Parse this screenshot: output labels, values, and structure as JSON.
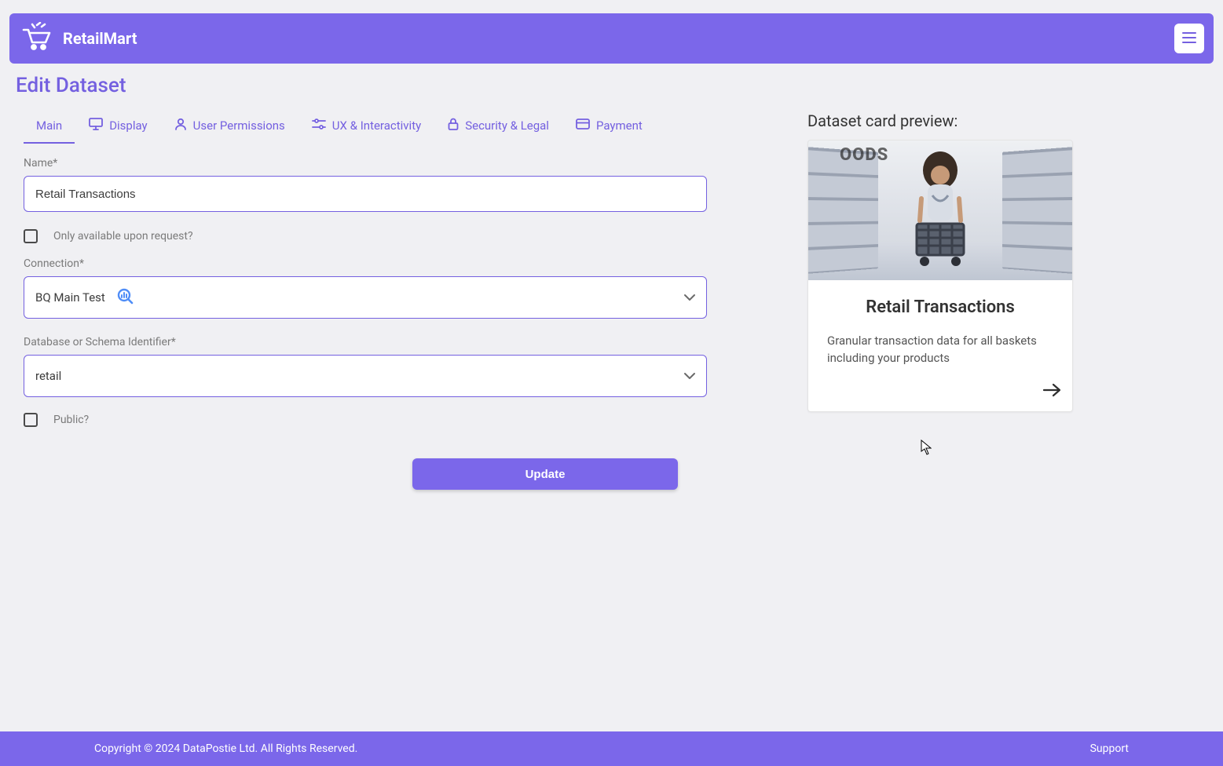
{
  "header": {
    "brand_name": "RetailMart"
  },
  "page": {
    "title": "Edit Dataset"
  },
  "tabs": [
    {
      "id": "main",
      "label": "Main",
      "icon": null,
      "active": true
    },
    {
      "id": "display",
      "label": "Display",
      "icon": "monitor-icon",
      "active": false
    },
    {
      "id": "perms",
      "label": "User Permissions",
      "icon": "user-icon",
      "active": false
    },
    {
      "id": "ux",
      "label": "UX & Interactivity",
      "icon": "sliders-icon",
      "active": false
    },
    {
      "id": "security",
      "label": "Security & Legal",
      "icon": "lock-icon",
      "active": false
    },
    {
      "id": "payment",
      "label": "Payment",
      "icon": "card-icon",
      "active": false
    }
  ],
  "form": {
    "name_label": "Name*",
    "name_value": "Retail Transactions",
    "request_only_label": "Only available upon request?",
    "request_only_checked": false,
    "connection_label": "Connection*",
    "connection_value": "BQ Main Test",
    "connection_icon": "bigquery-icon",
    "schema_label": "Database or Schema Identifier*",
    "schema_value": "retail",
    "public_label": "Public?",
    "public_checked": false,
    "submit_label": "Update"
  },
  "preview": {
    "heading": "Dataset card preview:",
    "card": {
      "image_sign_text": "OODS",
      "title": "Retail Transactions",
      "description": "Granular transaction data for all baskets including your products"
    }
  },
  "footer": {
    "copyright": "Copyright © 2024 DataPostie Ltd. All Rights Reserved.",
    "support_label": "Support"
  }
}
